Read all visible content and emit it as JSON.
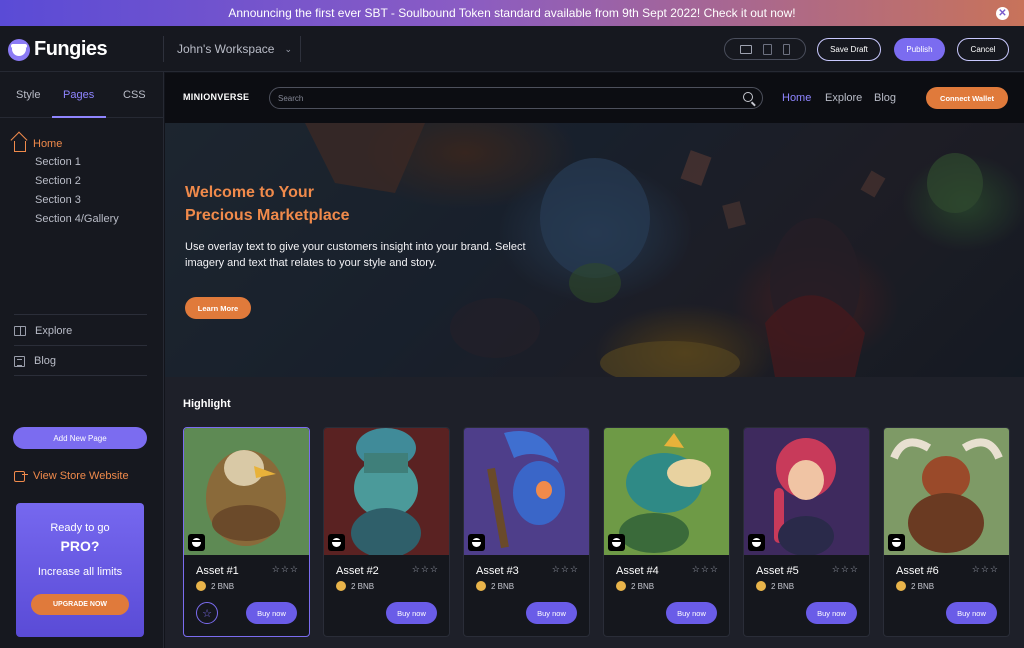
{
  "announcement": {
    "text": "Announcing the first ever SBT - Soulbound Token standard available from 9th Sept 2022! Check it out now!"
  },
  "topbar": {
    "logo_text": "Fungies",
    "workspace": "John's Workspace",
    "save_draft": "Save Draft",
    "publish": "Publish",
    "cancel": "Cancel"
  },
  "sidebar": {
    "tabs": [
      "Style",
      "Pages",
      "CSS"
    ],
    "active_tab": "Pages",
    "home": "Home",
    "sections": [
      "Section 1",
      "Section 2",
      "Section 3",
      "Section 4/Gallery"
    ],
    "explore": "Explore",
    "blog": "Blog",
    "add_page": "Add New Page",
    "view_store": "View Store Website",
    "promo": {
      "line1": "Ready to go",
      "line2": "PRO?",
      "line3": "Increase all limits",
      "button": "UPGRADE NOW"
    }
  },
  "site": {
    "brand": "MINIONVERSE",
    "search_placeholder": "Search",
    "nav": [
      "Home",
      "Explore",
      "Blog"
    ],
    "connect": "Connect Wallet"
  },
  "hero": {
    "title_line1": "Welcome to Your",
    "title_line2": "Precious Marketplace",
    "text": "Use overlay text to give your customers insight into your brand. Select imagery and text that relates to your style and story.",
    "button": "Learn More"
  },
  "highlight": {
    "title": "Highlight",
    "cards": [
      {
        "name": "Asset #1",
        "price": "2 BNB",
        "buy": "Buy now",
        "rating": 0
      },
      {
        "name": "Asset #2",
        "price": "2 BNB",
        "buy": "Buy now",
        "rating": 0
      },
      {
        "name": "Asset #3",
        "price": "2 BNB",
        "buy": "Buy now",
        "rating": 0
      },
      {
        "name": "Asset #4",
        "price": "2 BNB",
        "buy": "Buy now",
        "rating": 0
      },
      {
        "name": "Asset #5",
        "price": "2 BNB",
        "buy": "Buy now",
        "rating": 0
      },
      {
        "name": "Asset #6",
        "price": "2 BNB",
        "buy": "Buy now",
        "rating": 0
      }
    ]
  },
  "colors": {
    "accent_purple": "#7b6cf0",
    "accent_orange": "#e07a3b",
    "background": "#12141b"
  }
}
